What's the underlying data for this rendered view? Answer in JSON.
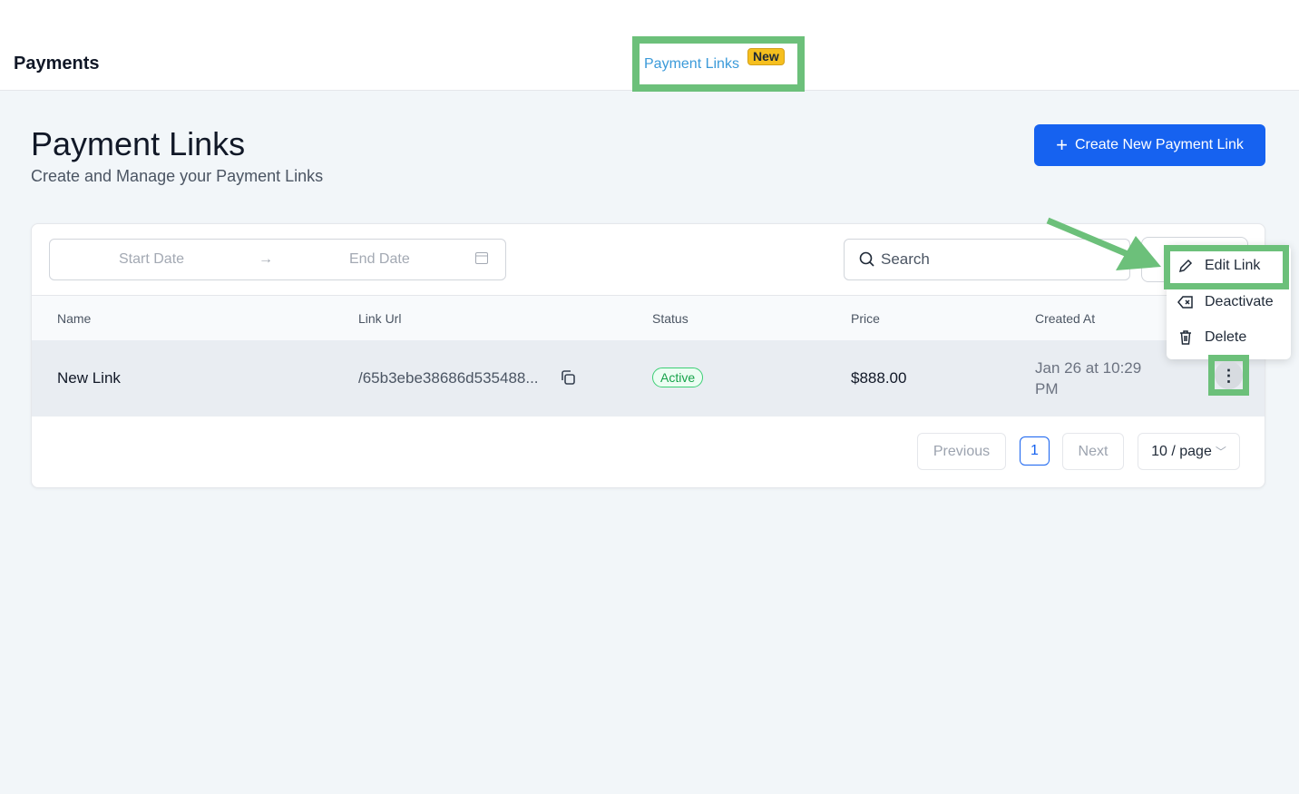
{
  "header": {
    "app_title": "Payments",
    "tab_label": "Payment Links",
    "tab_badge": "New"
  },
  "page": {
    "title": "Payment Links",
    "subtitle": "Create and Manage your Payment Links",
    "create_button": "Create New Payment Link"
  },
  "filters": {
    "start_placeholder": "Start Date",
    "end_placeholder": "End Date",
    "search_placeholder": "Search"
  },
  "table": {
    "columns": [
      "Name",
      "Link Url",
      "Status",
      "Price",
      "Created At"
    ],
    "rows": [
      {
        "name": "New Link",
        "url": "/65b3ebe38686d535488...",
        "status": "Active",
        "price": "$888.00",
        "created_line1": "Jan 26 at 10:29",
        "created_line2": "PM"
      }
    ]
  },
  "pagination": {
    "previous": "Previous",
    "current": "1",
    "next": "Next",
    "page_size": "10 / page"
  },
  "menu": {
    "items": [
      "Edit Link",
      "Deactivate",
      "Delete"
    ]
  },
  "colors": {
    "primary": "#1662f0",
    "highlight": "#6cc07a",
    "active": "#16a34a",
    "badge": "#f6bf1e"
  }
}
